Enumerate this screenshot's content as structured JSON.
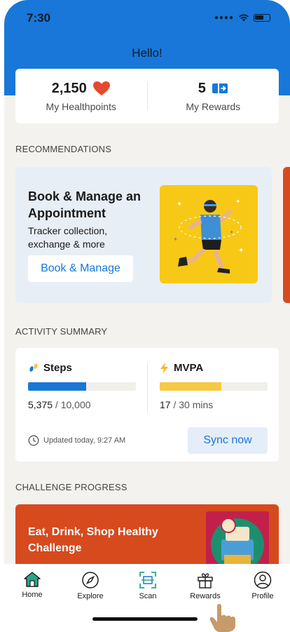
{
  "status": {
    "time": "7:30"
  },
  "header": {
    "greeting": "Hello!"
  },
  "stats": {
    "healthpoints_value": "2,150",
    "healthpoints_label": "My Healthpoints",
    "rewards_value": "5",
    "rewards_label": "My Rewards"
  },
  "sections": {
    "recommendations": "RECOMMENDATIONS",
    "activity": "ACTIVITY SUMMARY",
    "challenge": "CHALLENGE PROGRESS"
  },
  "recommendation": {
    "title": "Book & Manage an Appointment",
    "subtitle": "Tracker collection, exchange & more",
    "button": "Book & Manage"
  },
  "activity": {
    "steps": {
      "label": "Steps",
      "value": "5,375",
      "goal": " / 10,000",
      "progress": 0.54
    },
    "mvpa": {
      "label": "MVPA",
      "value": "17",
      "goal": " / 30 mins",
      "progress": 0.57
    },
    "updated": "Updated today, 9:27 AM",
    "sync_button": "Sync now"
  },
  "challenge": {
    "title": "Eat, Drink, Shop Healthy Challenge"
  },
  "nav": {
    "home": "Home",
    "explore": "Explore",
    "scan": "Scan",
    "rewards": "Rewards",
    "profile": "Profile"
  },
  "colors": {
    "brand_blue": "#1877d8",
    "steps_bar": "#1877d8",
    "mvpa_bar": "#f7c844",
    "challenge_bg": "#d64a1e",
    "heart": "#e64a2e"
  }
}
